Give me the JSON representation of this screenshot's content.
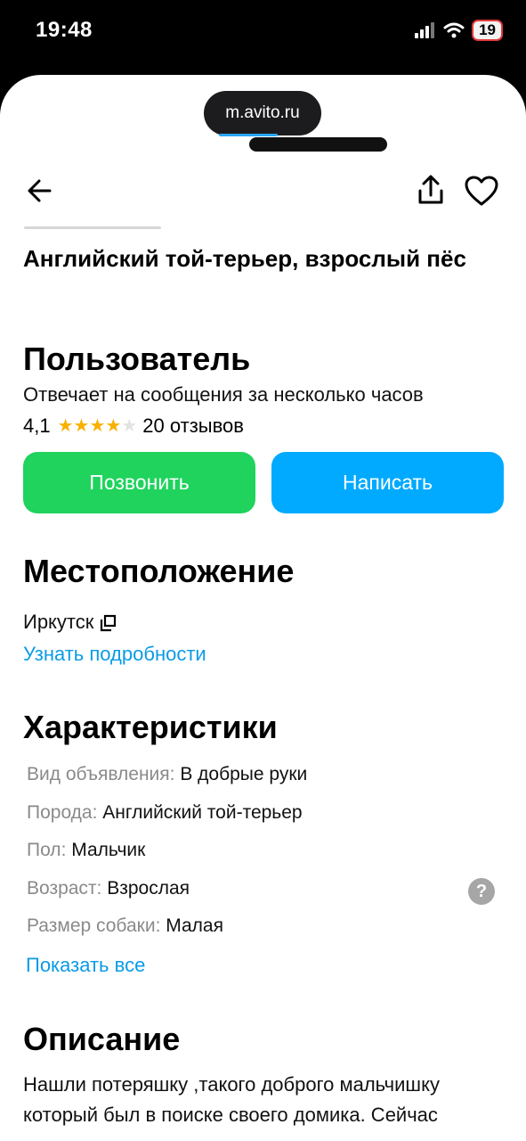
{
  "status": {
    "time": "19:48",
    "battery": "19"
  },
  "browser": {
    "url": "m.avito.ru"
  },
  "listing": {
    "title": "Английский той-терьер, взрослый пёс"
  },
  "seller": {
    "heading": "Пользователь",
    "response_time": "Отвечает на сообщения за несколько часов",
    "rating": "4,1",
    "stars_filled": 4,
    "stars_total": 5,
    "reviews": "20 отзывов"
  },
  "actions": {
    "call": "Позвонить",
    "write": "Написать"
  },
  "location": {
    "heading": "Местоположение",
    "city": "Иркутск",
    "details_link": "Узнать подробности"
  },
  "specs": {
    "heading": "Характеристики",
    "rows": [
      {
        "key": "Вид объявления:",
        "value": "В добрые руки"
      },
      {
        "key": "Порода:",
        "value": "Английский той-терьер"
      },
      {
        "key": "Пол:",
        "value": "Мальчик"
      },
      {
        "key": "Возраст:",
        "value": "Взрослая"
      },
      {
        "key": "Размер собаки:",
        "value": "Малая"
      }
    ],
    "show_all": "Показать все",
    "help_icon": "?"
  },
  "description": {
    "heading": "Описание",
    "text": "Нашли потеряшку ,такого доброго мальчишку который был в поиске своего домика. Сейчас"
  },
  "colors": {
    "call": "#1fd35d",
    "write": "#01aaff",
    "link": "#0a9be6",
    "star": "#f7b100"
  },
  "icons": [
    "signal-icon",
    "wifi-icon",
    "back-arrow-icon",
    "share-icon",
    "heart-icon",
    "star-icon",
    "copy-icon",
    "help-icon"
  ]
}
